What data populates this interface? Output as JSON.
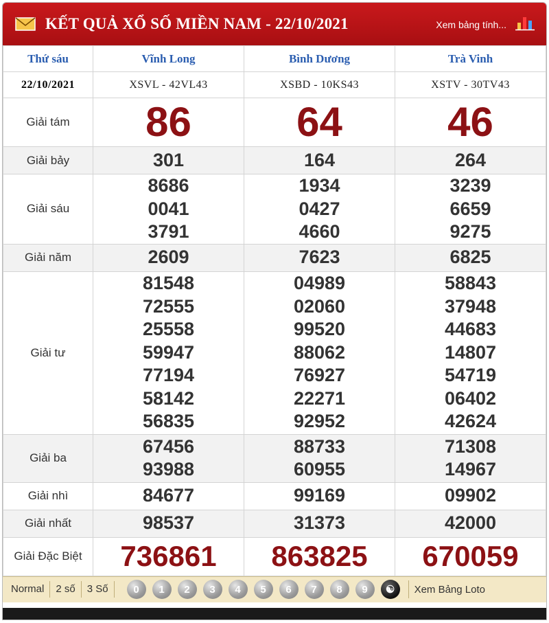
{
  "header": {
    "title": "KẾT QUẢ XỔ SỐ MIỀN NAM - 22/10/2021",
    "view_link": "Xem bảng tính..."
  },
  "table": {
    "day": "Thứ sáu",
    "date": "22/10/2021",
    "provinces": [
      "Vĩnh Long",
      "Bình Dương",
      "Trà Vinh"
    ],
    "codes": [
      "XSVL - 42VL43",
      "XSBD - 10KS43",
      "XSTV - 30TV43"
    ],
    "prizes": [
      {
        "label": "Giải tám",
        "style": "big",
        "values": [
          [
            "86"
          ],
          [
            "64"
          ],
          [
            "46"
          ]
        ]
      },
      {
        "label": "Giải bảy",
        "style": "num",
        "values": [
          [
            "301"
          ],
          [
            "164"
          ],
          [
            "264"
          ]
        ]
      },
      {
        "label": "Giải sáu",
        "style": "num",
        "values": [
          [
            "8686",
            "0041",
            "3791"
          ],
          [
            "1934",
            "0427",
            "4660"
          ],
          [
            "3239",
            "6659",
            "9275"
          ]
        ]
      },
      {
        "label": "Giải năm",
        "style": "num",
        "values": [
          [
            "2609"
          ],
          [
            "7623"
          ],
          [
            "6825"
          ]
        ]
      },
      {
        "label": "Giải tư",
        "style": "num",
        "values": [
          [
            "81548",
            "72555",
            "25558",
            "59947",
            "77194",
            "58142",
            "56835"
          ],
          [
            "04989",
            "02060",
            "99520",
            "88062",
            "76927",
            "22271",
            "92952"
          ],
          [
            "58843",
            "37948",
            "44683",
            "14807",
            "54719",
            "06402",
            "42624"
          ]
        ]
      },
      {
        "label": "Giải ba",
        "style": "num",
        "values": [
          [
            "67456",
            "93988"
          ],
          [
            "88733",
            "60955"
          ],
          [
            "71308",
            "14967"
          ]
        ]
      },
      {
        "label": "Giải nhì",
        "style": "num",
        "values": [
          [
            "84677"
          ],
          [
            "99169"
          ],
          [
            "09902"
          ]
        ]
      },
      {
        "label": "Giải nhất",
        "style": "num",
        "values": [
          [
            "98537"
          ],
          [
            "31373"
          ],
          [
            "42000"
          ]
        ]
      },
      {
        "label": "Giải Đặc Biệt",
        "style": "special",
        "values": [
          [
            "736861"
          ],
          [
            "863825"
          ],
          [
            "670059"
          ]
        ]
      }
    ]
  },
  "toolbar": {
    "modes": [
      "Normal",
      "2 số",
      "3 Số"
    ],
    "digits": [
      "0",
      "1",
      "2",
      "3",
      "4",
      "5",
      "6",
      "7",
      "8",
      "9"
    ],
    "all_icon": "yin-yang-icon",
    "loto_link": "Xem Bảng Loto"
  },
  "colors": {
    "header_red": "#b41418",
    "prize_red": "#8c1114",
    "province_blue": "#2a5db0",
    "toolbar_bg": "#f3e8c6"
  }
}
